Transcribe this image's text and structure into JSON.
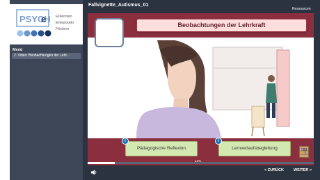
{
  "logo": {
    "word": "PSYCH",
    "word2": "e",
    "lines": [
      "Erkennen",
      "Entwickeln",
      "Fördern"
    ]
  },
  "sidebar": {
    "menu_label": "Menü",
    "items": [
      {
        "label": "2. Video: Beobachtungen der Lehr..."
      }
    ]
  },
  "header": {
    "title": "Fallvignette_Autismus_01",
    "resources": "Ressourcen"
  },
  "slide": {
    "title": "Beobachtungen der Lehrkraft"
  },
  "buttons": [
    {
      "label": "Pädagogische Reflexion"
    },
    {
      "label": "Lernverlaufsbegleitung"
    }
  ],
  "badges": [
    {
      "symbol": "i"
    },
    {
      "symbol": "i"
    }
  ],
  "progress": {
    "label": "12%",
    "value": 0.12
  },
  "nav": {
    "back": "< ZURÜCK",
    "next": "WEITER >"
  },
  "colors": {
    "accent": "#8b2f3e",
    "sidebar": "#3d4657",
    "button": "#d4e8b2",
    "badge": "#1a6fb5"
  },
  "icons": [
    "logo-icon",
    "sound-icon",
    "bookshelf-icon",
    "info-icon"
  ]
}
